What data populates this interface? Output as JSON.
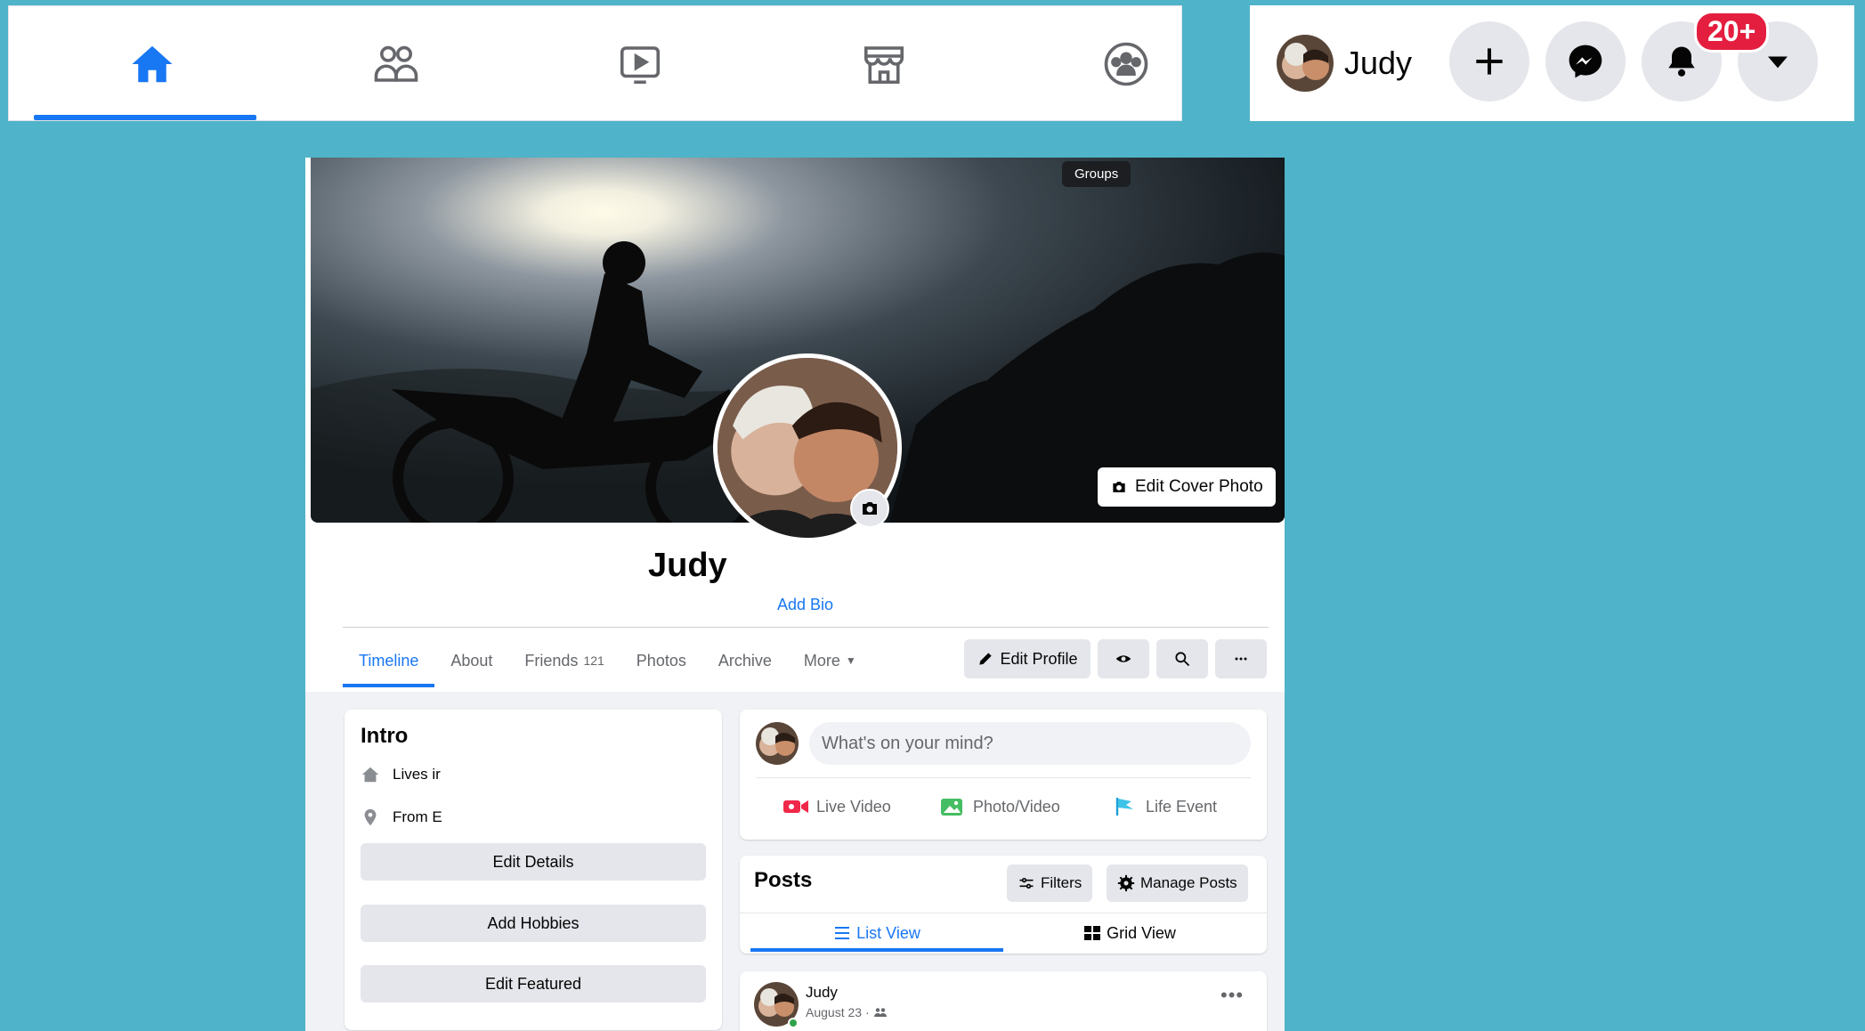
{
  "nav": {
    "items": [
      {
        "name": "home",
        "active": true
      },
      {
        "name": "friends",
        "active": false
      },
      {
        "name": "watch",
        "active": false
      },
      {
        "name": "marketplace",
        "active": false
      },
      {
        "name": "groups",
        "active": false
      }
    ],
    "accent": "#1877f2"
  },
  "account": {
    "user_name": "Judy",
    "notification_badge": "20+"
  },
  "profile": {
    "tooltip": "Groups",
    "edit_cover_label": "Edit Cover Photo",
    "name": "Judy",
    "add_bio_label": "Add Bio",
    "tabs": {
      "timeline": "Timeline",
      "about": "About",
      "friends": "Friends",
      "friends_count": "121",
      "photos": "Photos",
      "archive": "Archive",
      "more": "More"
    },
    "edit_profile_label": "Edit Profile"
  },
  "intro": {
    "title": "Intro",
    "lives_in": "Lives ir",
    "from": "From E",
    "edit_details": "Edit Details",
    "add_hobbies": "Add Hobbies",
    "edit_featured": "Edit Featured"
  },
  "composer": {
    "placeholder": "What's on your mind?",
    "live_video": "Live Video",
    "photo_video": "Photo/Video",
    "life_event": "Life Event"
  },
  "posts": {
    "title": "Posts",
    "filters": "Filters",
    "manage_posts": "Manage Posts",
    "list_view": "List View",
    "grid_view": "Grid View"
  },
  "post": {
    "author": "Judy",
    "date": "August 23 ·"
  }
}
